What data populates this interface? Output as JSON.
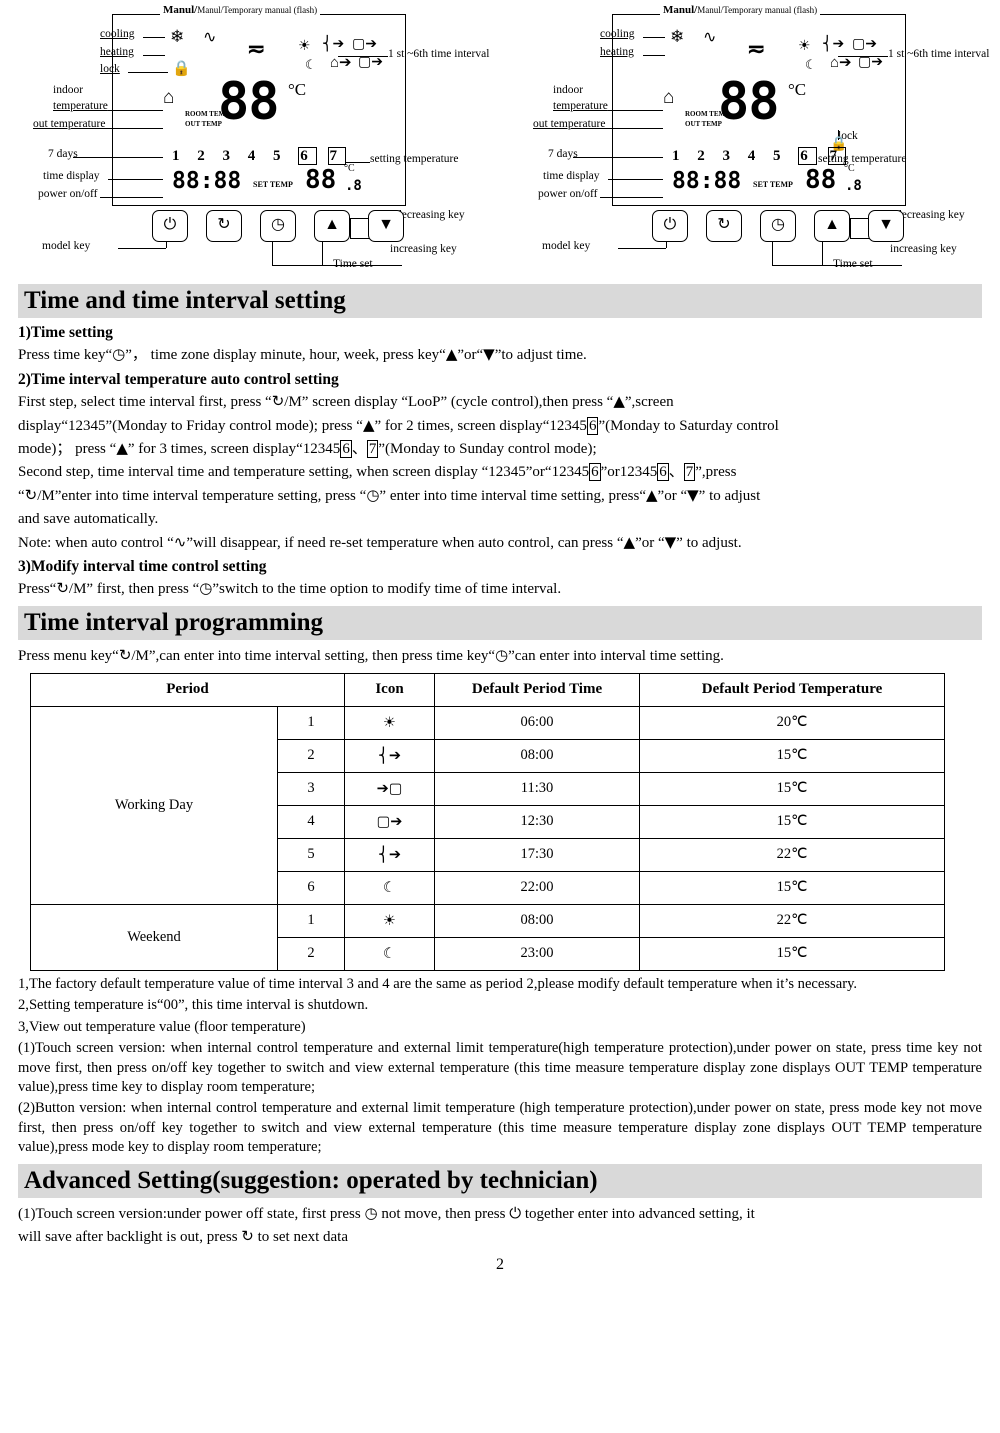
{
  "diagram": {
    "manul_title": "Manul/Temporary manual (flash)",
    "labels": {
      "cooling": "cooling",
      "heating": "heating",
      "lock": "lock",
      "indoor_temperature": "indoor",
      "indoor_temperature2": "temperature",
      "out_temperature": "out temperature",
      "seven_days": "7 days",
      "time_display": "time display",
      "power_onoff": "power on/off",
      "model_key": "model key",
      "interval_note": "1 st ~6th time interval",
      "setting_temperature": "setting temperature",
      "decreasing_key": "decreasing key",
      "increasing_key": "increasing key",
      "time_set": "Time set"
    },
    "lcd": {
      "room_temp": "ROOM TEMP",
      "out_temp": "OUT TEMP",
      "big_value": "88",
      "degree": "°C",
      "days": [
        "1",
        "2",
        "3",
        "4",
        "5",
        "6",
        "7"
      ],
      "clock": "88:88",
      "set_temp_label": "SET TEMP",
      "set_value": "88",
      "set_decimal": ".8",
      "set_degree": "°C"
    },
    "buttons": [
      "power",
      "mode",
      "clock",
      "up",
      "down"
    ]
  },
  "sections": {
    "time_setting_title": "Time and time interval setting",
    "s1_title": "1)Time setting",
    "s1_text_a": "Press time key“",
    "s1_text_b": "”，  time zone display minute, hour, week, press key“",
    "s1_text_c": "”or“",
    "s1_text_d": "”to adjust time.",
    "s2_title": "2)Time interval temperature auto control setting",
    "s2_p1_a": "First step, select time interval first, press “",
    "s2_p1_b": "/M” screen display “LooP” (cycle control),then press “",
    "s2_p1_c": "”,screen",
    "s2_p2_a": "display“12345”(Monday to Friday control mode); press “",
    "s2_p2_b": "” for 2 times, screen display“12345",
    "s2_p2_c": "6",
    "s2_p2_d": "”(Monday to Saturday control",
    "s2_p3_a": "mode)； press “",
    "s2_p3_b": "” for 3 times, screen display“12345",
    "s2_p3_c": "6",
    "s2_p3_d": "、",
    "s2_p3_e": "7",
    "s2_p3_f": "”(Monday to Sunday control mode);",
    "s2_p4_a": "Second step, time interval time and temperature setting, when screen display “12345”or“12345",
    "s2_p4_b": "6",
    "s2_p4_c": "”or12345",
    "s2_p4_d": "6",
    "s2_p4_e": "、",
    "s2_p4_f": "7",
    "s2_p4_g": "”,press",
    "s2_p5_a": "“",
    "s2_p5_b": "/M”enter into time interval temperature setting, press “",
    "s2_p5_c": "” enter into time interval time setting, press“",
    "s2_p5_d": "”or “",
    "s2_p5_e": "” to adjust",
    "s2_p6": "and save automatically.",
    "s2_note_a": "Note: when auto control “",
    "s2_note_b": "”will disappear, if need re-set temperature when auto control, can press “",
    "s2_note_c": "”or “",
    "s2_note_d": "” to adjust.",
    "s3_title": "3)Modify interval time control setting",
    "s3_a": "Press“",
    "s3_b": "/M” first, then press “",
    "s3_c": "”switch to the time option to modify time of time interval.",
    "prog_title": "Time interval programming",
    "prog_intro_a": "Press menu key“",
    "prog_intro_b": "/M”,can enter into time interval setting, then press time key“",
    "prog_intro_c": "”can enter into interval time setting."
  },
  "table": {
    "headers": [
      "Period",
      "",
      "Icon",
      "Default Period Time",
      "Default Period Temperature"
    ],
    "groups": [
      {
        "name": "Working Day",
        "rows": [
          {
            "n": "1",
            "icon": "sun-icon",
            "time": "06:00",
            "temp": "20℃"
          },
          {
            "n": "2",
            "icon": "home-out-icon",
            "time": "08:00",
            "temp": "15℃"
          },
          {
            "n": "3",
            "icon": "house-in-icon",
            "time": "11:30",
            "temp": "15℃"
          },
          {
            "n": "4",
            "icon": "house-out-icon",
            "time": "12:30",
            "temp": "15℃"
          },
          {
            "n": "5",
            "icon": "home-in-icon",
            "time": "17:30",
            "temp": "22℃"
          },
          {
            "n": "6",
            "icon": "moon-icon",
            "time": "22:00",
            "temp": "15℃"
          }
        ]
      },
      {
        "name": "Weekend",
        "rows": [
          {
            "n": "1",
            "icon": "sun-icon",
            "time": "08:00",
            "temp": "22℃"
          },
          {
            "n": "2",
            "icon": "moon-icon",
            "time": "23:00",
            "temp": "15℃"
          }
        ]
      }
    ]
  },
  "notes": {
    "n1": "1,The factory default temperature value of time interval 3 and 4 are the same as period 2,please modify default temperature when it’s necessary.",
    "n2": "2,Setting temperature is“00”, this time interval is shutdown.",
    "n3": "3,View out temperature value (floor temperature)",
    "n4": "(1)Touch screen version: when internal control temperature and external limit temperature(high temperature protection),under power on state, press time key not move first, then press on/off key together to switch and view external temperature (this time measure temperature display zone displays OUT TEMP temperature value),press time key to display room temperature;",
    "n5": "(2)Button version: when internal control temperature and external limit temperature (high temperature protection),under power on state, press mode key not move first, then press on/off key together to switch and view external temperature (this time measure temperature display zone displays OUT TEMP temperature value),press mode key to display room temperature;"
  },
  "advanced": {
    "title": "Advanced Setting(suggestion: operated by technician)",
    "line_a": "(1)Touch screen version:under power off state, first press",
    "line_b": "not move, then press",
    "line_c": "together enter into advanced setting, it",
    "line_d": "will save after backlight is out, press",
    "line_e": "to set next data"
  },
  "page_number": "2"
}
